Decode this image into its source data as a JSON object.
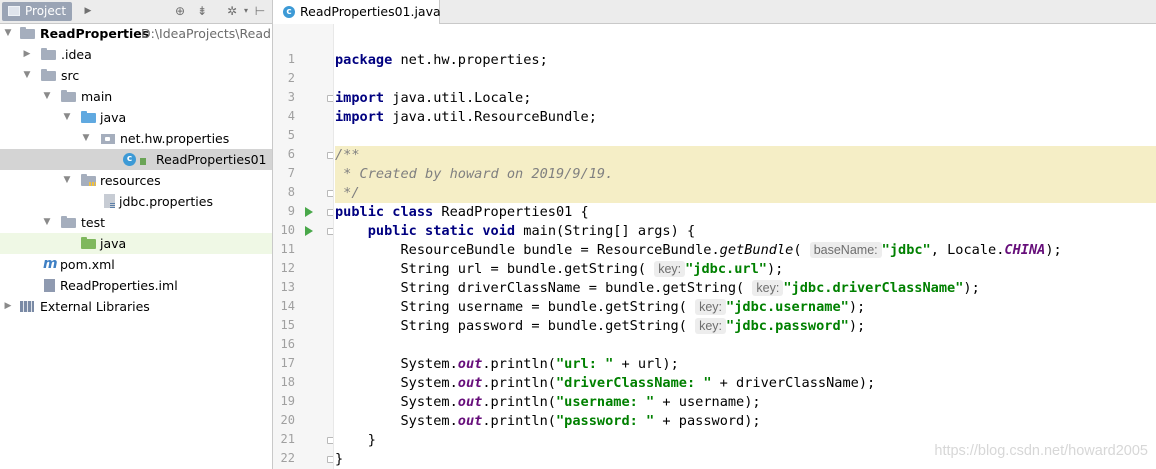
{
  "project_panel": {
    "tab_label": "Project",
    "toolbar_icons": [
      "dropdown-arrow-icon",
      "locate-icon",
      "collapse-icon",
      "settings-icon",
      "hide-icon"
    ],
    "tree": [
      {
        "label": "ReadProperties",
        "path": "D:\\IdeaProjects\\ReadP",
        "icon": "module-folder-icon",
        "expanded": true
      },
      {
        "label": ".idea",
        "icon": "folder-icon",
        "expanded": false
      },
      {
        "label": "src",
        "icon": "folder-icon",
        "expanded": true
      },
      {
        "label": "main",
        "icon": "folder-icon",
        "expanded": true
      },
      {
        "label": "java",
        "icon": "source-folder-icon",
        "expanded": false
      },
      {
        "label": "net.hw.properties",
        "icon": "package-icon",
        "expanded": true
      },
      {
        "label": "ReadProperties01",
        "icon": "class-icon",
        "selected": true
      },
      {
        "label": "resources",
        "icon": "resources-folder-icon",
        "expanded": true
      },
      {
        "label": "jdbc.properties",
        "icon": "properties-file-icon"
      },
      {
        "label": "test",
        "icon": "folder-icon",
        "expanded": true
      },
      {
        "label": "java",
        "icon": "test-folder-icon",
        "highlighted": true
      },
      {
        "label": "pom.xml",
        "icon": "maven-icon"
      },
      {
        "label": "ReadProperties.iml",
        "icon": "iml-file-icon"
      },
      {
        "label": "External Libraries",
        "icon": "libraries-icon",
        "expanded": false
      }
    ]
  },
  "editor": {
    "tab_label": "ReadProperties01.java",
    "line_numbers": [
      "1",
      "2",
      "3",
      "4",
      "5",
      "6",
      "7",
      "8",
      "9",
      "10",
      "11",
      "12",
      "13",
      "14",
      "15",
      "16",
      "17",
      "18",
      "19",
      "20",
      "21",
      "22"
    ],
    "code": {
      "l1_kw": "package",
      "l1_rest": " net.hw.properties;",
      "l3_kw": "import",
      "l3_rest": " java.util.Locale;",
      "l4_kw": "import",
      "l4_rest": " java.util.ResourceBundle;",
      "l6": "/**",
      "l7": " * Created by howard on 2019/9/19.",
      "l8": " */",
      "l9_kw": "public class",
      "l9_rest": " ReadProperties01 {",
      "l10_indent": "    ",
      "l10_kw": "public static void",
      "l10_rest": " main(String[] args) {",
      "l11_pre": "        ResourceBundle bundle = ResourceBundle.",
      "l11_method": "getBundle",
      "l11_paren": "(",
      "l11_hint": "baseName:",
      "l11_str": "\"jdbc\"",
      "l11_mid": ", Locale.",
      "l11_const": "CHINA",
      "l11_end": ");",
      "l12_pre": "        String url = bundle.getString(",
      "l12_hint": "key:",
      "l12_str": "\"jdbc.url\"",
      "l12_end": ");",
      "l13_pre": "        String driverClassName = bundle.getString(",
      "l13_hint": "key:",
      "l13_str": "\"jdbc.driverClassName\"",
      "l13_end": ");",
      "l14_pre": "        String username = bundle.getString(",
      "l14_hint": "key:",
      "l14_str": "\"jdbc.username\"",
      "l14_end": ");",
      "l15_pre": "        String password = bundle.getString(",
      "l15_hint": "key:",
      "l15_str": "\"jdbc.password\"",
      "l15_end": ");",
      "l17_pre": "        System.",
      "l17_out": "out",
      "l17_mid": ".println(",
      "l17_str": "\"url: \"",
      "l17_end": " + url);",
      "l18_pre": "        System.",
      "l18_out": "out",
      "l18_mid": ".println(",
      "l18_str": "\"driverClassName: \"",
      "l18_end": " + driverClassName);",
      "l19_pre": "        System.",
      "l19_out": "out",
      "l19_mid": ".println(",
      "l19_str": "\"username: \"",
      "l19_end": " + username);",
      "l20_pre": "        System.",
      "l20_out": "out",
      "l20_mid": ".println(",
      "l20_str": "\"password: \"",
      "l20_end": " + password);",
      "l21": "    }",
      "l22": "}"
    }
  },
  "watermark": "https://blog.csdn.net/howard2005",
  "colors": {
    "keyword": "#000080",
    "string": "#008000",
    "comment": "#808080",
    "static_field": "#660e7a",
    "doc_highlight": "#f5eec6",
    "selection": "#d4d4d4"
  }
}
